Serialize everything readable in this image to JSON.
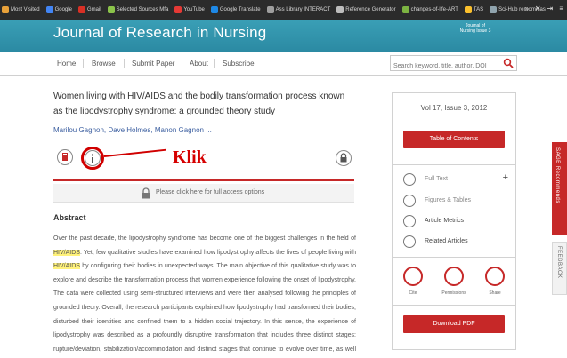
{
  "browser": {
    "bookmarks": [
      {
        "label": "Most Visited",
        "color": "#e8a13a"
      },
      {
        "label": "Google",
        "color": "#4285f4"
      },
      {
        "label": "Gmail",
        "color": "#d93025"
      },
      {
        "label": "Selected Sources Mfa",
        "color": "#8bc34a"
      },
      {
        "label": "YouTube",
        "color": "#e53935"
      },
      {
        "label": "Google Translate",
        "color": "#1e88e5"
      },
      {
        "label": "Ass Library INTERACT",
        "color": "#9e9e9e"
      },
      {
        "label": "Reference Generator",
        "color": "#bdbdbd"
      },
      {
        "label": "changes-of-life-ART",
        "color": "#7cb342"
      },
      {
        "label": "TAS",
        "color": "#fbc02d"
      },
      {
        "label": "Sci-Hub remomnias",
        "color": "#90a4ae"
      }
    ],
    "right_icons": [
      "»",
      "✕",
      "⇥",
      "≡"
    ]
  },
  "header": {
    "journal_title": "Journal of Research in Nursing",
    "logo_text": "Journal of Nursing Issue 3"
  },
  "nav": {
    "items": [
      "Home",
      "Browse",
      "Submit Paper",
      "About",
      "Subscribe"
    ],
    "search_placeholder": "Search keyword, title, author, DOI"
  },
  "article": {
    "title": "Women living with HIV/AIDS and the bodily transformation process known as the lipodystrophy syndrome: a grounded theory study",
    "authors": "Marilou Gagnon, Dave Holmes, Manon Gagnon ...",
    "annotation": "Klik",
    "access_text": "Please click here for full access options",
    "abstract_heading": "Abstract",
    "abstract_parts": [
      "Over the past decade, the lipodystrophy syndrome has become one of the biggest challenges in the field of ",
      "HIV/AIDS",
      ". Yet, few qualitative studies have examined how lipodystrophy affects the lives of people living with ",
      "HIV/AIDS",
      " by configuring their bodies in unexpected ways. The main objective of this qualitative study was to explore and describe the transformation process that women experience following the onset of lipodystrophy. The data were collected using semi-structured interviews and were then analysed following the principles of grounded theory. Overall, the research participants explained how lipodystrophy had transformed their bodies, disturbed their identities and confined them to a hidden social trajectory. In this sense, the experience of lipodystrophy was described as a profoundly disruptive transformation that includes three distinct stages: rupture/deviation, stabilization/accommodation and distinct stages that continue to evolve over time, as well as the experience of lipodystrophy..."
    ]
  },
  "sidebar": {
    "volume": "Vol 17, Issue 3, 2012",
    "toc_button": "Table of Contents",
    "items": [
      "Full Text",
      "Figures & Tables",
      "Article Metrics",
      "Related Articles"
    ],
    "share": [
      "Cite",
      "Permissions",
      "Share"
    ],
    "download_button": "Download PDF"
  },
  "side_tabs": {
    "red": "SAGE Recommends",
    "grey": "FEEDBACK"
  }
}
